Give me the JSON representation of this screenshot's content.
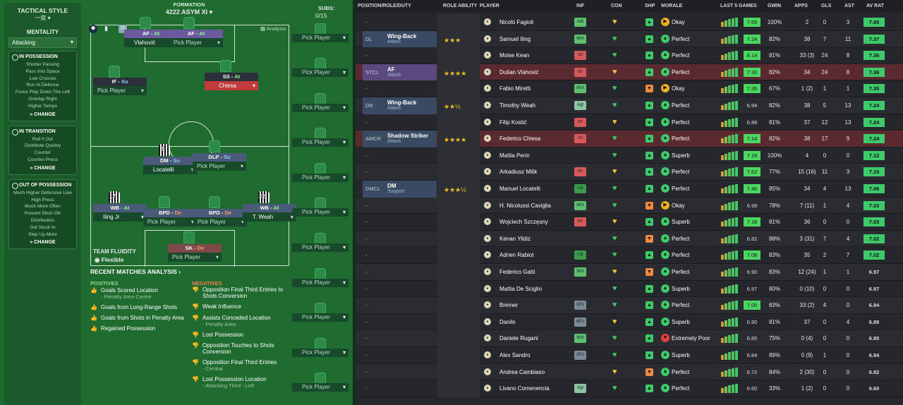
{
  "sidebar": {
    "title": "TACTICAL STYLE",
    "subtitle": "一奕 ▾",
    "mentality_label": "MENTALITY",
    "mentality_value": "Attacking",
    "in_possession": {
      "title": "IN POSSESSION",
      "items": [
        "Shorter Passing",
        "Pass Into Space",
        "Low Crosses",
        "Run At Defence",
        "Focus Play Down The Left",
        "Overlap Right",
        "Higher Tempo"
      ],
      "change": "CHANGE"
    },
    "in_transition": {
      "title": "IN TRANSITION",
      "items": [
        "Roll It Out",
        "Distribute Quickly",
        "Counter",
        "Counter-Press"
      ],
      "change": "CHANGE"
    },
    "out_of_possession": {
      "title": "OUT OF POSSESSION",
      "items": [
        "Much Higher Defensive Line",
        "High Press",
        "Much More Often",
        "Prevent Short GK",
        "Distribution",
        "Get Stuck In",
        "Step Up More"
      ],
      "change": "CHANGE"
    }
  },
  "formation": {
    "label": "FORMATION",
    "name": "4222 ASYM XI",
    "analysis": "Analysis",
    "subs_label": "SUBS:",
    "subs_count": "0/15",
    "fluidity_label": "TEAM FLUIDITY",
    "fluidity_value": "Flexible",
    "players": [
      {
        "role": "AF",
        "duty": "At",
        "name": "Vlahović"
      },
      {
        "role": "AF",
        "duty": "At",
        "name": "Pick Player"
      },
      {
        "role": "IF",
        "duty": "Su",
        "name": "Pick Player"
      },
      {
        "role": "SS",
        "duty": "At",
        "name": "Chiesa"
      },
      {
        "role": "DM",
        "duty": "Su",
        "name": "Locatelli"
      },
      {
        "role": "DLP",
        "duty": "Su",
        "name": "Pick Player"
      },
      {
        "role": "WB",
        "duty": "At",
        "name": "Iling Jr"
      },
      {
        "role": "BPD",
        "duty": "De",
        "name": "Pick Player"
      },
      {
        "role": "BPD",
        "duty": "De",
        "name": "Pick Player"
      },
      {
        "role": "WB",
        "duty": "At",
        "name": "T. Weah"
      },
      {
        "role": "SK",
        "duty": "De",
        "name": "Pick Player"
      }
    ],
    "shirt_numbers": {
      "dm": "5",
      "wbl": "17",
      "wbr": "22"
    },
    "subs_pick": "Pick Player"
  },
  "analysis": {
    "title": "RECENT MATCHES ANALYSIS ›",
    "positives_label": "POSITIVES",
    "negatives_label": "NEGATIVES",
    "positives": [
      {
        "text": "Goals Scored Location",
        "sub": "- Penalty Area Centre"
      },
      {
        "text": "Goals from Long-Range Shots",
        "sub": ""
      },
      {
        "text": "Goals from Shots in Penalty Area",
        "sub": ""
      },
      {
        "text": "Regained Possession",
        "sub": ""
      }
    ],
    "negatives": [
      {
        "text": "Opposition Final Third Entries to Shots Conversion",
        "sub": ""
      },
      {
        "text": "Weak Influence",
        "sub": ""
      },
      {
        "text": "Assists Conceded Location",
        "sub": "- Penalty Area"
      },
      {
        "text": "Lost Possession",
        "sub": ""
      },
      {
        "text": "Opposition Touches to Shots Conversion",
        "sub": ""
      },
      {
        "text": "Opposition Final Third Entries",
        "sub": "- Central"
      },
      {
        "text": "Lost Possession Location",
        "sub": "- Attacking Third - Left"
      }
    ]
  },
  "table": {
    "headers": {
      "pos": "POSITION/ROLE/DUTY",
      "ra": "ROLE ABILITY",
      "player": "PLAYER",
      "inf": "INF",
      "con": "CON",
      "shp": "SHP",
      "morale": "MORALE",
      "last5": "LAST 5 GAMES",
      "gwin": "GWIN",
      "apps": "APPS",
      "gls": "GLS",
      "ast": "AST",
      "avrat": "AV RAT"
    },
    "rows": [
      {
        "pos": "-",
        "role": "",
        "duty": "",
        "stars": "",
        "av": "",
        "name": "Nicolò Fagioli",
        "inf": "Adt",
        "con": "♥",
        "shp": "▲",
        "morale": "Okay",
        "rating": "7.65",
        "gwin": "100%",
        "apps": "2",
        "gls": "0",
        "ast": "3",
        "avrat": "7.65"
      },
      {
        "pos": "DL",
        "role": "Wing-Back",
        "duty": "Attack",
        "stars": "★★★",
        "av": "",
        "name": "Samuel Iling",
        "inf": "Wnt",
        "con": "♥",
        "shp": "▲",
        "morale": "Perfect",
        "rating": "7.24",
        "gwin": "82%",
        "apps": "38",
        "gls": "7",
        "ast": "11",
        "avrat": "7.37"
      },
      {
        "pos": "-",
        "role": "",
        "duty": "",
        "stars": "",
        "av": "",
        "name": "Moise Kean",
        "inf": "Int",
        "con": "♥",
        "shp": "▲",
        "morale": "Perfect",
        "rating": "8.14",
        "gwin": "81%",
        "apps": "33 (3)",
        "gls": "24",
        "ast": "8",
        "avrat": "7.36"
      },
      {
        "pos": "STCL",
        "role": "AF",
        "duty": "Attack",
        "stars": "★★★★",
        "av": "",
        "name": "Dušan Vlahović",
        "inf": "Int",
        "con": "♥",
        "shp": "▲",
        "morale": "Perfect",
        "rating": "7.30",
        "gwin": "82%",
        "apps": "34",
        "gls": "24",
        "ast": "8",
        "avrat": "7.36"
      },
      {
        "pos": "-",
        "role": "",
        "duty": "",
        "stars": "",
        "av": "",
        "name": "Fabio Miretti",
        "inf": "Wnt",
        "con": "♥",
        "shp": "▼",
        "morale": "Okay",
        "rating": "7.35",
        "gwin": "67%",
        "apps": "1 (2)",
        "gls": "1",
        "ast": "1",
        "avrat": "7.35"
      },
      {
        "pos": "DR",
        "role": "Wing-Back",
        "duty": "Attack",
        "stars": "★★½",
        "av": "",
        "name": "Timothy Weah",
        "inf": "Agt",
        "con": "♥",
        "shp": "▲",
        "morale": "Perfect",
        "rating": "6.94",
        "gwin": "82%",
        "apps": "38",
        "gls": "5",
        "ast": "13",
        "avrat": "7.24"
      },
      {
        "pos": "-",
        "role": "",
        "duty": "",
        "stars": "",
        "av": "",
        "name": "Filip Kostić",
        "inf": "Int",
        "con": "♥",
        "shp": "▲",
        "morale": "Perfect",
        "rating": "6.88",
        "gwin": "81%",
        "apps": "37",
        "gls": "12",
        "ast": "13",
        "avrat": "7.24"
      },
      {
        "pos": "AMCR",
        "role": "Shadow Striker",
        "duty": "Attack",
        "stars": "★★★★",
        "av": "",
        "name": "Federico Chiesa",
        "inf": "Int",
        "con": "♥",
        "shp": "▲",
        "morale": "Perfect",
        "rating": "7.14",
        "gwin": "82%",
        "apps": "38",
        "gls": "17",
        "ast": "9",
        "avrat": "7.24"
      },
      {
        "pos": "-",
        "role": "",
        "duty": "",
        "stars": "",
        "av": "",
        "name": "Mattia Perin",
        "inf": "",
        "con": "♥",
        "shp": "▲",
        "morale": "Superb",
        "rating": "7.16",
        "gwin": "100%",
        "apps": "4",
        "gls": "0",
        "ast": "0",
        "avrat": "7.12"
      },
      {
        "pos": "-",
        "role": "",
        "duty": "",
        "stars": "",
        "av": "",
        "name": "Arkadiusz Milik",
        "inf": "Int",
        "con": "♥",
        "shp": "▲",
        "morale": "Perfect",
        "rating": "7.62",
        "gwin": "77%",
        "apps": "15 (16)",
        "gls": "11",
        "ast": "3",
        "avrat": "7.10"
      },
      {
        "pos": "DMCL",
        "role": "DM",
        "duty": "Support",
        "stars": "★★★½",
        "av": "",
        "name": "Manuel Locatelli",
        "inf": "Ldr",
        "con": "♥",
        "shp": "▲",
        "morale": "Perfect",
        "rating": "7.40",
        "gwin": "85%",
        "apps": "34",
        "gls": "4",
        "ast": "13",
        "avrat": "7.06"
      },
      {
        "pos": "-",
        "role": "",
        "duty": "",
        "stars": "",
        "av": "",
        "name": "H. Nicolussi Caviglia",
        "inf": "Wnt",
        "con": "♥",
        "shp": "▼",
        "morale": "Okay",
        "rating": "6.98",
        "gwin": "78%",
        "apps": "7 (11)",
        "gls": "1",
        "ast": "4",
        "avrat": "7.03"
      },
      {
        "pos": "-",
        "role": "",
        "duty": "",
        "stars": "",
        "av": "",
        "name": "Wojciech Szczęsny",
        "inf": "Int",
        "con": "♥",
        "shp": "▲",
        "morale": "Superb",
        "rating": "7.18",
        "gwin": "81%",
        "apps": "36",
        "gls": "0",
        "ast": "0",
        "avrat": "7.03"
      },
      {
        "pos": "-",
        "role": "",
        "duty": "",
        "stars": "",
        "av": "",
        "name": "Kenan Yildiz",
        "inf": "",
        "con": "♥",
        "shp": "▼",
        "morale": "Perfect",
        "rating": "6.82",
        "gwin": "88%",
        "apps": "3 (31)",
        "gls": "7",
        "ast": "4",
        "avrat": "7.02"
      },
      {
        "pos": "-",
        "role": "",
        "duty": "",
        "stars": "",
        "av": "",
        "name": "Adrien Rabiot",
        "inf": "Ldr",
        "con": "♥",
        "shp": "▲",
        "morale": "Perfect",
        "rating": "7.08",
        "gwin": "83%",
        "apps": "35",
        "gls": "2",
        "ast": "7",
        "avrat": "7.02"
      },
      {
        "pos": "-",
        "role": "",
        "duty": "",
        "stars": "",
        "av": "",
        "name": "Federico Gatti",
        "inf": "Wnt",
        "con": "♥",
        "shp": "▼",
        "morale": "Perfect",
        "rating": "6.90",
        "gwin": "83%",
        "apps": "12 (24)",
        "gls": "1",
        "ast": "1",
        "avrat": "6.97"
      },
      {
        "pos": "-",
        "role": "",
        "duty": "",
        "stars": "",
        "av": "",
        "name": "Mattia De Sciglio",
        "inf": "",
        "con": "♥",
        "shp": "▲",
        "morale": "Superb",
        "rating": "6.97",
        "gwin": "80%",
        "apps": "0 (10)",
        "gls": "0",
        "ast": "0",
        "avrat": "6.97"
      },
      {
        "pos": "-",
        "role": "",
        "duty": "",
        "stars": "",
        "av": "",
        "name": "Bremer",
        "inf": "nEU",
        "con": "♥",
        "shp": "▲",
        "morale": "Perfect",
        "rating": "7.00",
        "gwin": "83%",
        "apps": "33 (2)",
        "gls": "4",
        "ast": "0",
        "avrat": "6.94"
      },
      {
        "pos": "-",
        "role": "",
        "duty": "",
        "stars": "",
        "av": "",
        "name": "Danilo",
        "inf": "nEU",
        "con": "♥",
        "shp": "▲",
        "morale": "Superb",
        "rating": "6.90",
        "gwin": "81%",
        "apps": "37",
        "gls": "0",
        "ast": "4",
        "avrat": "6.89"
      },
      {
        "pos": "-",
        "role": "",
        "duty": "",
        "stars": "",
        "av": "",
        "name": "Daniele Rugani",
        "inf": "Wnt",
        "con": "♥",
        "shp": "▲",
        "morale": "Extremely Poor",
        "rating": "6.85",
        "gwin": "75%",
        "apps": "0 (4)",
        "gls": "0",
        "ast": "0",
        "avrat": "6.85"
      },
      {
        "pos": "-",
        "role": "",
        "duty": "",
        "stars": "",
        "av": "",
        "name": "Alex Sandro",
        "inf": "nEU",
        "con": "♥",
        "shp": "▲",
        "morale": "Superb",
        "rating": "6.84",
        "gwin": "89%",
        "apps": "0 (9)",
        "gls": "1",
        "ast": "0",
        "avrat": "6.84"
      },
      {
        "pos": "-",
        "role": "",
        "duty": "",
        "stars": "",
        "av": "",
        "name": "Andrea Cambiaso",
        "inf": "",
        "con": "♥",
        "shp": "▼",
        "morale": "Perfect",
        "rating": "6.72",
        "gwin": "84%",
        "apps": "2 (30)",
        "gls": "0",
        "ast": "0",
        "avrat": "6.82"
      },
      {
        "pos": "-",
        "role": "",
        "duty": "",
        "stars": "",
        "av": "",
        "name": "Livano Comenencia",
        "inf": "Agt",
        "con": "♥",
        "shp": "▲",
        "morale": "Perfect",
        "rating": "6.60",
        "gwin": "33%",
        "apps": "1 (2)",
        "gls": "0",
        "ast": "0",
        "avrat": "6.60"
      }
    ]
  }
}
